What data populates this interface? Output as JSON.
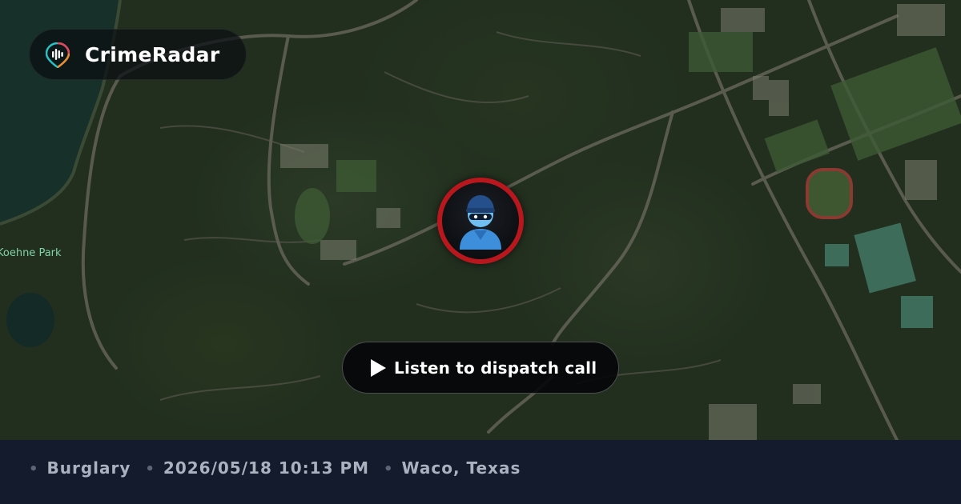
{
  "app": {
    "name": "CrimeRadar",
    "logo_icon": "radar-pin-logo-icon"
  },
  "map": {
    "label_park": "Koehne Park",
    "marker_icon": "burglar-avatar-icon"
  },
  "player": {
    "button_label": "Listen to dispatch call",
    "icon": "play-icon"
  },
  "incident": {
    "type": "Burglary",
    "datetime": "2026/05/18 10:13 PM",
    "location": "Waco, Texas"
  },
  "colors": {
    "marker_ring": "#b8181d",
    "footer_bg": "#141b2d",
    "footer_text": "#aab2c0",
    "logo_teal": "#27c2c5",
    "logo_orange": "#f08a2a"
  }
}
